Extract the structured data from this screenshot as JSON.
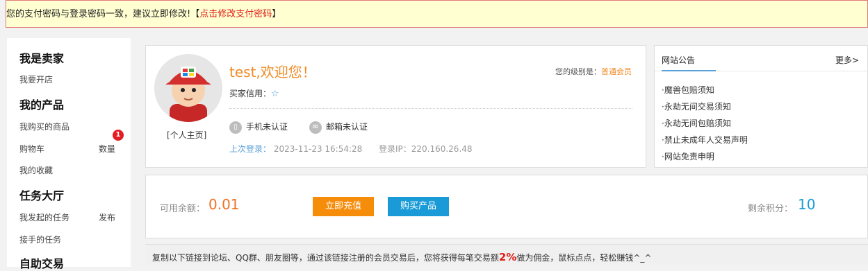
{
  "warning": {
    "text": "您的支付密码与登录密码一致，建议立即修改!【",
    "link": "点击修改支付密码",
    "suffix": "】"
  },
  "sidebar": {
    "seller_heading": "我是卖家",
    "open_shop": "我要开店",
    "products_heading": "我的产品",
    "purchased": "我购买的商品",
    "cart": "购物车",
    "cart_qty_label": "数量",
    "cart_badge": "1",
    "favorites": "我的收藏",
    "task_heading": "任务大厅",
    "my_tasks": "我发起的任务",
    "publish": "发布",
    "accepted_tasks": "接手的任务",
    "self_trade_heading": "自助交易"
  },
  "profile": {
    "home_link": "[个人主页]",
    "greeting": "test,欢迎您！",
    "level_label": "您的级别是：",
    "level_value": "普通会员",
    "credit_label": "买家信用：",
    "credit_star": "☆",
    "phone_status": "手机未认证",
    "email_status": "邮箱未认证",
    "last_login_label": "上次登录：",
    "last_login_time": "2023-11-23 16:54:28",
    "login_ip_label": "登录IP：",
    "login_ip": "220.160.26.48"
  },
  "notices": {
    "title": "网站公告",
    "more": "更多>",
    "items": [
      "·魔兽包赔须知",
      "·永劫无间交易须知",
      "·永劫无间包赔须知",
      "·禁止未成年人交易声明",
      "·网站免责申明"
    ]
  },
  "balance": {
    "label": "可用余额：",
    "value": "0.01",
    "recharge_button": "立即充值",
    "buy_button": "购买产品",
    "points_label": "剩余积分：",
    "points_value": "10"
  },
  "promo": {
    "text": "复制以下链接到论坛、QQ群、朋友圈等，通过该链接注册的会员交易后，您将获得每笔交易额",
    "percent": "2%",
    "suffix": "做为佣金，鼠标点点，轻松赚钱^_^"
  },
  "colors": {
    "accent_orange": "#f08a24",
    "accent_blue": "#1a9bd7",
    "warning_red": "#e0201a"
  }
}
